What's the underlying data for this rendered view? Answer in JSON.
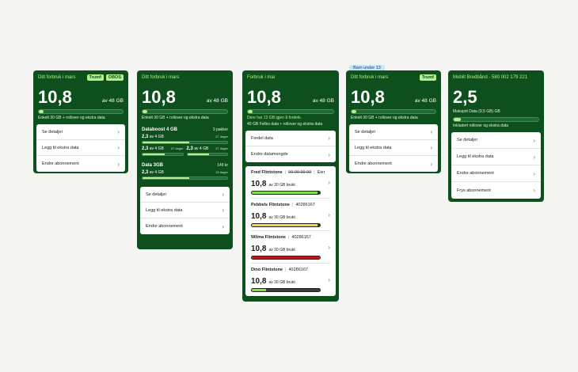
{
  "card1": {
    "title": "Ditt forbruk i mars",
    "tags": [
      "Trumf",
      "OBOS"
    ],
    "amount": "10,8",
    "unit": "av 48 GB",
    "progress": 0.06,
    "note": "Enkelt 30 GB + rollover og ekstra data",
    "menu": [
      "Se detaljer",
      "Legg til ekstra data",
      "Endre abonnement"
    ]
  },
  "card2": {
    "title": "Ditt forbruk i mars",
    "amount": "10,8",
    "unit": "av 48 GB",
    "progress": 0.06,
    "note": "Enkelt 30 GB + rollover og ekstra data",
    "boost": {
      "title": "Databoost 4 GB",
      "count": "3 pakker",
      "row_value": "2,3",
      "row_unit": "av 4 GB",
      "row_days": "27 dager",
      "row_progress": 0.55,
      "mini": [
        {
          "value": "2,3",
          "unit": "av 4 GB",
          "days": "27 dager",
          "progress": 0.55
        },
        {
          "value": "2,3",
          "unit": "av 4 GB",
          "days": "27 dager",
          "progress": 0.55
        }
      ]
    },
    "data3": {
      "title": "Data 3GB",
      "right": "149 kr",
      "value": "2,3",
      "unit": "av 4 GB",
      "days": "13 dager",
      "progress": 0.55
    },
    "menu": [
      "Se detaljer",
      "Legg til ekstra data",
      "Endre abonnement"
    ]
  },
  "card3": {
    "title": "Forbruk i mai",
    "amount": "10,8",
    "unit": "av 48 GB",
    "progress": 0.06,
    "note_green": "Dere har 13 GB igjen å fordele.",
    "note": "40 GB Felles data + rollover og ekstra data",
    "menu": [
      "Fordel data",
      "Endre datamengde"
    ],
    "members": [
      {
        "name": "Fred Flintstone",
        "number": "99 99 99 99",
        "role": "Eier",
        "strike": true,
        "amount": "10,8",
        "unit": "av 30 GB brukt",
        "progress": 0.97,
        "color": "#7ee04a"
      },
      {
        "name": "Pebbels Flintstone",
        "number": "40286167",
        "role": "",
        "strike": false,
        "amount": "10,8",
        "unit": "av 30 GB brukt",
        "progress": 0.97,
        "color": "#f2d54a"
      },
      {
        "name": "Wilma Flintstone",
        "number": "40286167",
        "role": "",
        "strike": false,
        "amount": "10,8",
        "unit": "av 30 GB brukt",
        "progress": 1.0,
        "color": "#b51c1c"
      },
      {
        "name": "Dino Flintstone",
        "number": "40286167",
        "role": "",
        "strike": false,
        "amount": "10,8",
        "unit": "av 30 GB brukt",
        "progress": 0.21,
        "color": "#7ee04a"
      }
    ]
  },
  "card4": {
    "badge": "Barn under 13",
    "title": "Ditt forbruk i mars",
    "tags": [
      "Trumf"
    ],
    "amount": "10,8",
    "unit": "av 48 GB",
    "progress": 0.06,
    "note": "Enkelt 30 GB + rollover og ekstra data",
    "menu": [
      "Se detaljer",
      "Legg til ekstra data",
      "Endre abonnement"
    ]
  },
  "card5": {
    "title": "Mobilt Bredbånd - 580 002 179 221",
    "amount": "2,5",
    "note_small": "Maksprit Data (9,5 GB) GB",
    "progress": 0.08,
    "note": "Inkludert rollover og ekstra data",
    "menu": [
      "Se detaljer",
      "Legg til ekstra data",
      "Endre abonnement",
      "Frys abonnement"
    ]
  },
  "colors": {
    "card_bg": "#0d4f1d",
    "accent": "#b6f08c"
  }
}
